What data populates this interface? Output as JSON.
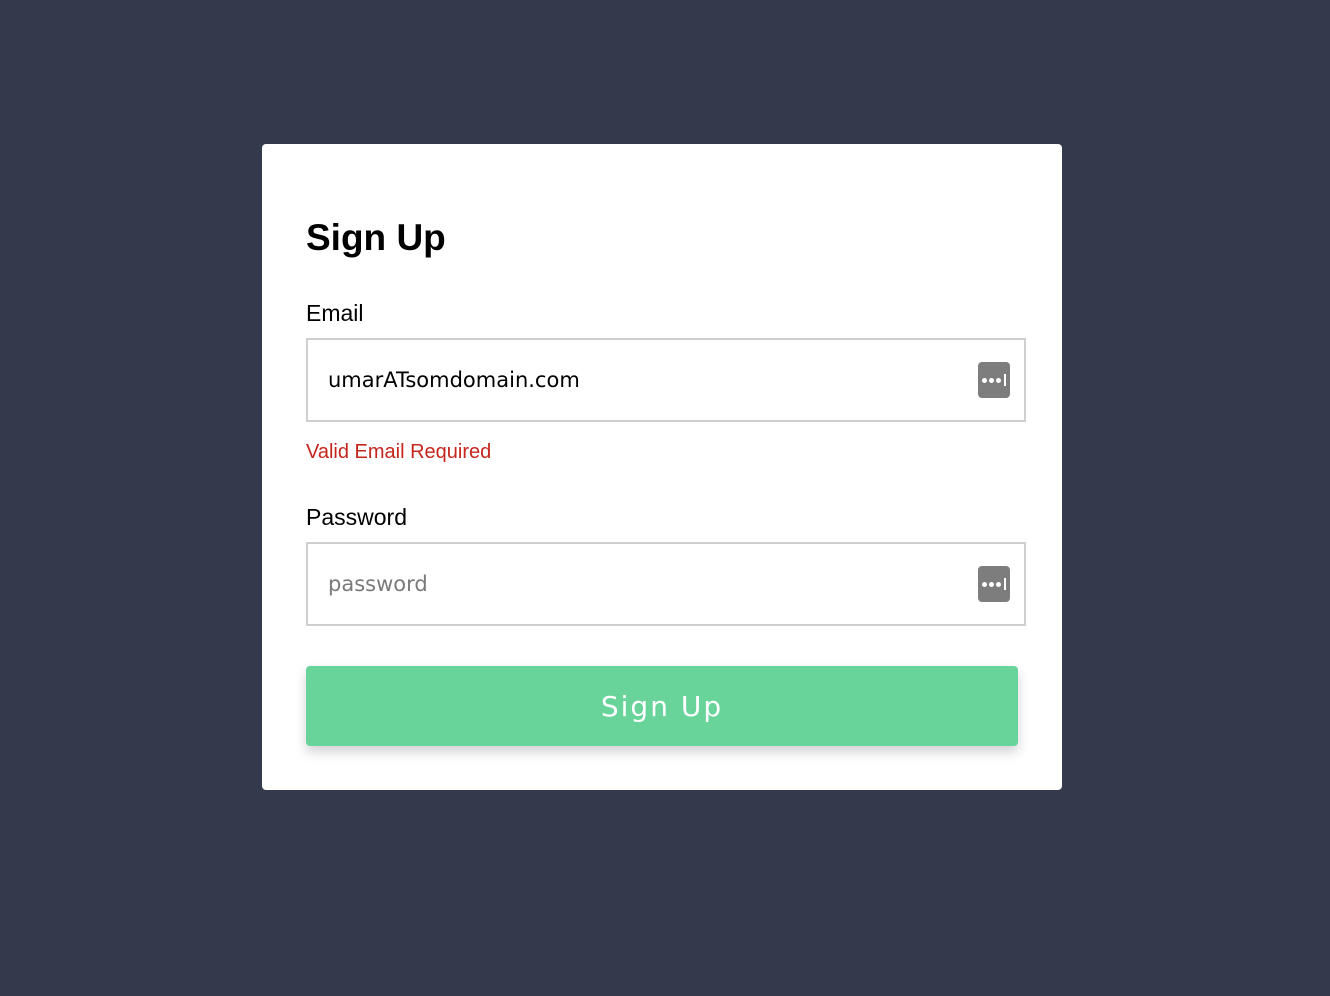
{
  "form": {
    "title": "Sign Up",
    "email": {
      "label": "Email",
      "value": "umarATsomdomain.com",
      "placeholder": "",
      "error": "Valid Email Required",
      "icon": "password-manager-icon"
    },
    "password": {
      "label": "Password",
      "value": "",
      "placeholder": "password",
      "icon": "password-manager-icon"
    },
    "submit_label": "Sign Up"
  },
  "colors": {
    "background": "#323a4c",
    "card": "#ffffff",
    "error": "#c4261d",
    "button": "#68d49a",
    "input_border": "#cfcfcf"
  }
}
